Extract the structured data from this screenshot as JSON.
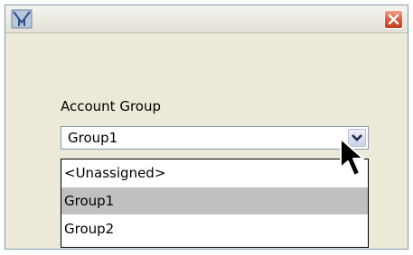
{
  "window": {
    "icon": "app-logo-icon",
    "close_icon": "close-icon"
  },
  "form": {
    "label": "Account Group",
    "combo_value": "Group1",
    "dropdown_icon": "chevron-down-icon"
  },
  "list": {
    "options": [
      "<Unassigned>",
      "Group1",
      "Group2"
    ],
    "selected_index": 1
  },
  "colors": {
    "window_bg": "#ece9d8",
    "selection_bg": "#c1c0c0",
    "close_red": "#d45a3a",
    "border_blue": "#7f9db9"
  }
}
